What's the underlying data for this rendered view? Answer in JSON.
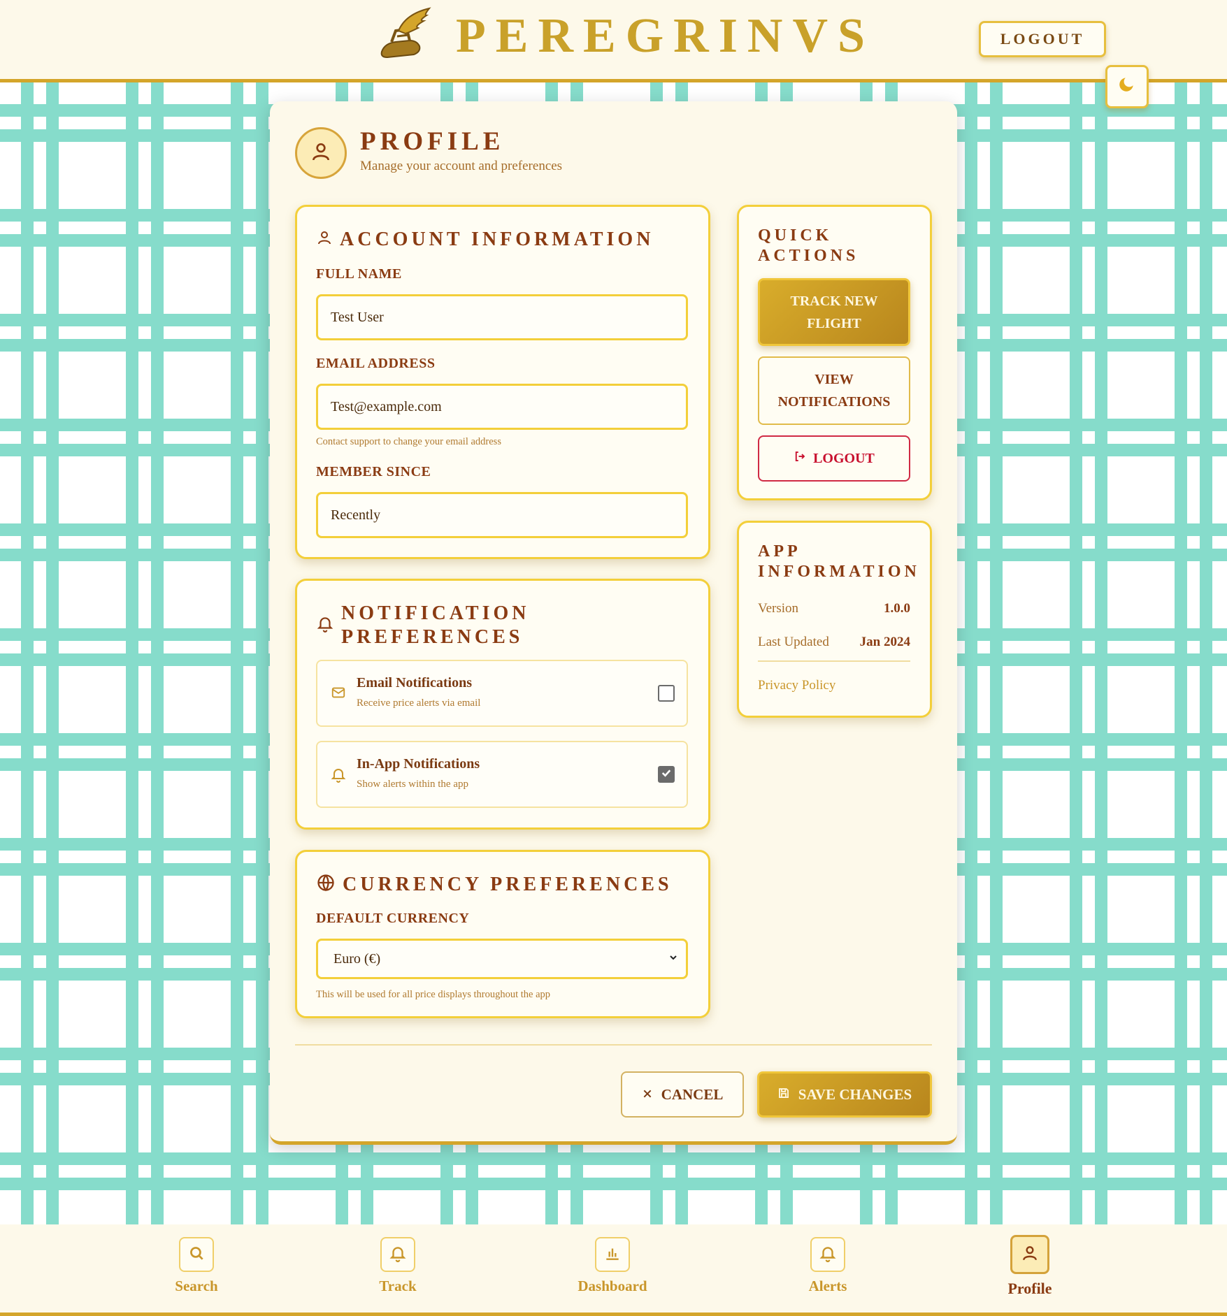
{
  "header": {
    "brand": "PEREGRINVS",
    "logout_label": "LOGOUT",
    "theme_icon": "moon-icon"
  },
  "page": {
    "title": "PROFILE",
    "subtitle": "Manage your account and preferences"
  },
  "account": {
    "title": "ACCOUNT INFORMATION",
    "full_name_label": "FULL NAME",
    "full_name_value": "Test User",
    "email_label": "EMAIL ADDRESS",
    "email_value": "Test@example.com",
    "email_hint": "Contact support to change your email address",
    "member_label": "MEMBER SINCE",
    "member_value": "Recently"
  },
  "notifications": {
    "title_line1": "NOTIFICATION",
    "title_line2": "PREFERENCES",
    "items": [
      {
        "title": "Email Notifications",
        "subtitle": "Receive price alerts via email",
        "checked": false,
        "icon": "mail-icon"
      },
      {
        "title": "In-App Notifications",
        "subtitle": "Show alerts within the app",
        "checked": true,
        "icon": "bell-icon"
      }
    ]
  },
  "currency": {
    "title": "CURRENCY PREFERENCES",
    "label": "DEFAULT CURRENCY",
    "selected": "Euro (€)",
    "hint": "This will be used for all price displays throughout the app"
  },
  "quick_actions": {
    "title_line1": "QUICK",
    "title_line2": "ACTIONS",
    "track_line1": "TRACK NEW",
    "track_line2": "FLIGHT",
    "view_line1": "VIEW",
    "view_line2": "NOTIFICATIONS",
    "logout": "LOGOUT"
  },
  "app_info": {
    "title_line1": "APP",
    "title_line2": "INFORMATION",
    "version_label": "Version",
    "version_value": "1.0.0",
    "updated_label": "Last Updated",
    "updated_value": "Jan 2024",
    "privacy": "Privacy Policy"
  },
  "actions": {
    "cancel": "CANCEL",
    "save": "SAVE CHANGES"
  },
  "bottom_nav": [
    {
      "label": "Search",
      "icon": "search-icon",
      "active": false
    },
    {
      "label": "Track",
      "icon": "bell-icon",
      "active": false
    },
    {
      "label": "Dashboard",
      "icon": "bar-chart-icon",
      "active": false
    },
    {
      "label": "Alerts",
      "icon": "bell-icon",
      "active": false
    },
    {
      "label": "Profile",
      "icon": "user-icon",
      "active": true
    }
  ],
  "colors": {
    "gold": "#c9a12a",
    "brown": "#8a3b12",
    "teal_pattern": "#86dccb",
    "logout_red": "#c8102e"
  }
}
